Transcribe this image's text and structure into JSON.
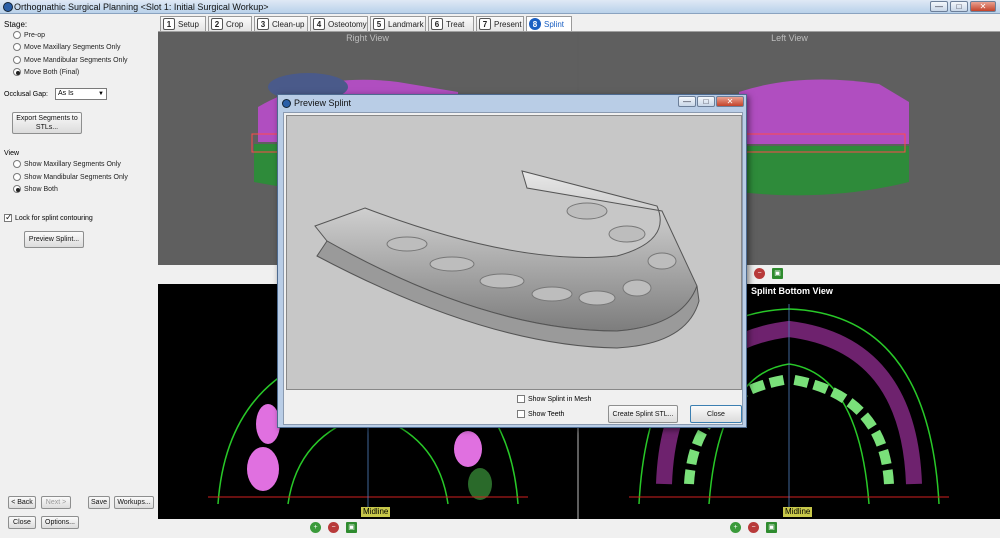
{
  "window": {
    "title": "Orthognathic Surgical Planning <Slot 1: Initial Surgical Workup>",
    "min_label": "—",
    "max_label": "□",
    "close_label": "✕"
  },
  "left_panel": {
    "stage_label": "Stage:",
    "stage_options": [
      "Pre-op",
      "Move Maxillary Segments Only",
      "Move Mandibular Segments Only",
      "Move Both (Final)"
    ],
    "stage_selected": 3,
    "occlusal_gap_label": "Occlusal Gap:",
    "occlusal_gap_value": "As Is",
    "export_button": "Export Segments to STLs...",
    "view_label": "View",
    "view_options": [
      "Show Maxillary Segments Only",
      "Show Mandibular Segments Only",
      "Show Both"
    ],
    "view_selected": 2,
    "lock_label": "Lock for splint contouring",
    "lock_checked": true,
    "preview_button": "Preview Splint...",
    "back_button": "< Back",
    "next_button": "Next >",
    "save_button": "Save",
    "workups_button": "Workups...",
    "close_button": "Close",
    "options_button": "Options..."
  },
  "tabs": [
    {
      "num": "1",
      "label": "Setup"
    },
    {
      "num": "2",
      "label": "Crop"
    },
    {
      "num": "3",
      "label": "Clean-up"
    },
    {
      "num": "4",
      "label": "Osteotomy"
    },
    {
      "num": "5",
      "label": "Landmark"
    },
    {
      "num": "6",
      "label": "Treat"
    },
    {
      "num": "7",
      "label": "Present"
    },
    {
      "num": "8",
      "label": "Splint"
    }
  ],
  "active_tab": 7,
  "views": {
    "right_view": "Right View",
    "left_view": "Left View",
    "splint_bottom_view": "Splint Bottom View",
    "midline_label": "Midline"
  },
  "dialog": {
    "title": "Preview Splint",
    "show_mesh_label": "Show Splint in Mesh",
    "show_mesh_checked": false,
    "show_teeth_label": "Show Teeth",
    "show_teeth_checked": false,
    "create_stl_button": "Create Splint STL...",
    "close_button": "Close"
  },
  "colors": {
    "maxillary": "#b04ec0",
    "mandibular": "#2e8b3a",
    "active_tab": "#1a5fc2"
  }
}
